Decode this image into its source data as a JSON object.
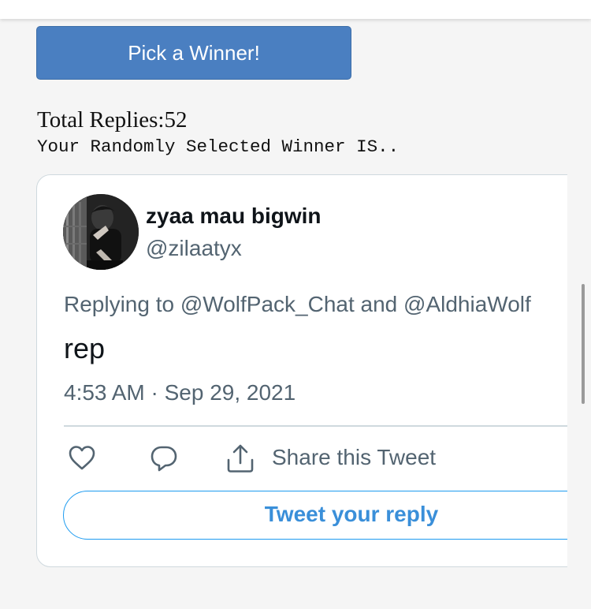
{
  "header": {
    "pick_button_label": "Pick a Winner!",
    "total_replies_label": "Total Replies:",
    "total_replies_count": "52",
    "winner_announcement": "Your Randomly Selected Winner IS.."
  },
  "tweet": {
    "display_name": "zyaa mau bigwin",
    "handle": "@zilaatyx",
    "replying_to": "Replying to @WolfPack_Chat and @AldhiaWolf",
    "text": "rep",
    "timestamp": "4:53 AM · Sep 29, 2021",
    "actions": {
      "like_icon": "heart-icon",
      "reply_icon": "speech-bubble-icon",
      "share_icon": "share-upload-icon",
      "share_label": "Share this Tweet"
    },
    "reply_button_label": "Tweet your reply"
  },
  "colors": {
    "page_background": "#f5f5f5",
    "pick_button": "#4a7fc1",
    "twitter_blue": "#1d9bf0",
    "secondary_text": "#536471",
    "primary_text": "#0f1419",
    "card_border": "#cfd9de"
  }
}
